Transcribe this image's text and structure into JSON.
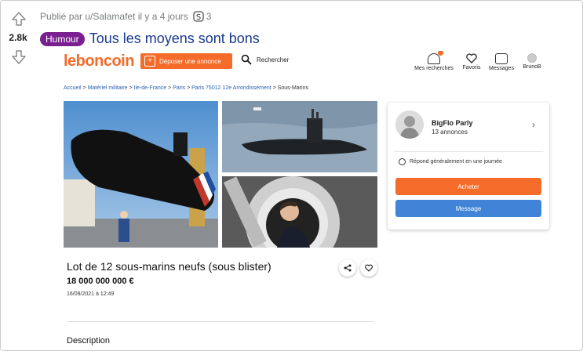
{
  "post": {
    "meta": "Publié par u/Salamafet il y a 4 jours",
    "award_count": "3",
    "score": "2.8k",
    "flair": "Humour",
    "title": "Tous les moyens sont bons"
  },
  "embed": {
    "header": {
      "logo": "leboncoin",
      "deposer_label": "Déposer une annonce",
      "search_label": "Rechercher",
      "nav": [
        {
          "label": "Mes recherches",
          "icon": "bell-icon"
        },
        {
          "label": "Favoris",
          "icon": "heart-icon"
        },
        {
          "label": "Messages",
          "icon": "message-icon"
        },
        {
          "label": "BrunoB",
          "icon": "user-icon"
        }
      ]
    },
    "breadcrumb": {
      "items": [
        "Accueil",
        "Matériel militaire",
        "Ile-de-France",
        "Paris",
        "Paris 75012 12e Arrondissement"
      ],
      "current": "Sous-Marins",
      "separator": ">"
    },
    "seller": {
      "name": "BigFlo Parly",
      "annonces": "13 annonces",
      "response": "Répond généralement en une journée",
      "buy_label": "Acheter",
      "message_label": "Message"
    },
    "listing": {
      "title": "Lot de 12 sous-marins neufs (sous blister)",
      "price": "18 000 000 000 €",
      "date": "16/09/2021 à 12:49",
      "description_heading": "Description"
    },
    "colors": {
      "brand": "#f56b2a",
      "message": "#4183d7",
      "flair": "#7a1f8f",
      "title": "#1a3a8f"
    }
  }
}
